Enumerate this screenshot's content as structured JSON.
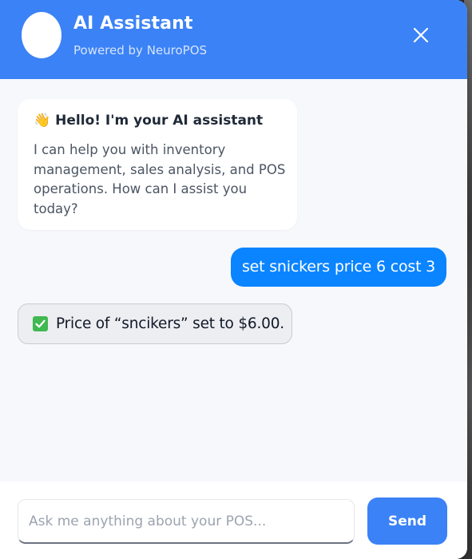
{
  "header": {
    "title": "AI Assistant",
    "subtitle": "Powered by NeuroPOS",
    "close_icon": "close-icon"
  },
  "messages": {
    "welcome": {
      "emoji": "👋",
      "heading": "Hello! I'm your AI assistant",
      "body": "I can help you with inventory management, sales analysis, and POS operations. How can I assist you today?"
    },
    "user": {
      "text": "set snickers price 6 cost 3"
    },
    "reply": {
      "icon": "check-icon",
      "text": "Price of “sncikers” set to $6.00."
    }
  },
  "composer": {
    "placeholder": "Ask me anything about your POS...",
    "send_label": "Send"
  },
  "colors": {
    "accent": "#3b82f6",
    "user_bubble": "#0a84ff",
    "check": "#3fb950"
  }
}
